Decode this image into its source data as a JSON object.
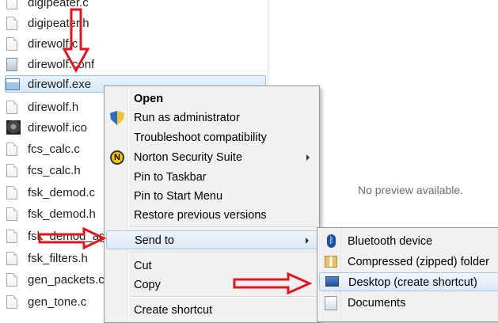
{
  "files": [
    {
      "name": "digipeater.c",
      "icon": "file-icon"
    },
    {
      "name": "digipeater.h",
      "icon": "file-icon"
    },
    {
      "name": "direwolf.c",
      "icon": "file-icon"
    },
    {
      "name": "direwolf.conf",
      "icon": "config-file-icon"
    },
    {
      "name": "direwolf.exe",
      "icon": "exe-icon",
      "selected": true
    },
    {
      "name": "direwolf.h",
      "icon": "file-icon"
    },
    {
      "name": "direwolf.ico",
      "icon": "wolf-image-icon"
    },
    {
      "name": "fcs_calc.c",
      "icon": "file-icon"
    },
    {
      "name": "fcs_calc.h",
      "icon": "file-icon"
    },
    {
      "name": "fsk_demod.c",
      "icon": "file-icon"
    },
    {
      "name": "fsk_demod.h",
      "icon": "file-icon"
    },
    {
      "name": "fsk_demod_agc.h",
      "icon": "file-icon"
    },
    {
      "name": "fsk_filters.h",
      "icon": "file-icon"
    },
    {
      "name": "gen_packets.c",
      "icon": "file-icon"
    },
    {
      "name": "gen_tone.c",
      "icon": "file-icon"
    }
  ],
  "preview": {
    "message": "No preview available."
  },
  "context_menu": {
    "open": "Open",
    "run_as_admin": "Run as administrator",
    "troubleshoot": "Troubleshoot compatibility",
    "norton": "Norton Security Suite",
    "pin_taskbar": "Pin to Taskbar",
    "pin_start": "Pin to Start Menu",
    "restore": "Restore previous versions",
    "send_to": "Send to",
    "cut": "Cut",
    "copy": "Copy",
    "create_shortcut": "Create shortcut"
  },
  "send_to_menu": {
    "bluetooth": "Bluetooth device",
    "compressed": "Compressed (zipped) folder",
    "desktop": "Desktop (create shortcut)",
    "documents": "Documents"
  },
  "colors": {
    "annotation_arrow": "#e8141c",
    "selection": "#d4e8fb",
    "menu_background": "#f1f1f1"
  }
}
